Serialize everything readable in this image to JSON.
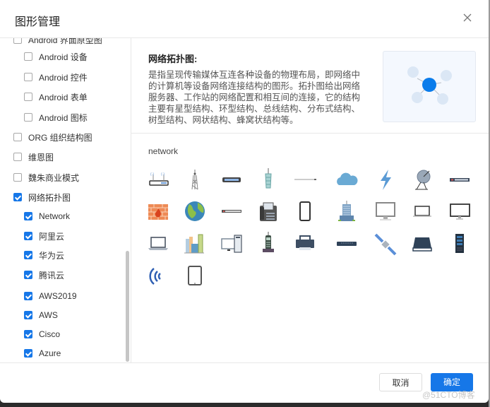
{
  "dialog": {
    "title": "图形管理",
    "close_icon": "close-icon"
  },
  "tree": {
    "items": [
      {
        "label": "Android 界面原型图",
        "checked": false,
        "level": 1,
        "partially_visible": true
      },
      {
        "label": "Android 设备",
        "checked": false,
        "level": 2
      },
      {
        "label": "Android 控件",
        "checked": false,
        "level": 2
      },
      {
        "label": "Android 表单",
        "checked": false,
        "level": 2
      },
      {
        "label": "Android 图标",
        "checked": false,
        "level": 2
      },
      {
        "label": "ORG 组织结构图",
        "checked": false,
        "level": 1
      },
      {
        "label": "维恩图",
        "checked": false,
        "level": 1
      },
      {
        "label": "魏朱商业模式",
        "checked": false,
        "level": 1
      },
      {
        "label": "网络拓扑图",
        "checked": true,
        "level": 1
      },
      {
        "label": "Network",
        "checked": true,
        "level": 2
      },
      {
        "label": "阿里云",
        "checked": true,
        "level": 2
      },
      {
        "label": "华为云",
        "checked": true,
        "level": 2
      },
      {
        "label": "腾讯云",
        "checked": true,
        "level": 2
      },
      {
        "label": "AWS2019",
        "checked": true,
        "level": 2
      },
      {
        "label": "AWS",
        "checked": true,
        "level": 2
      },
      {
        "label": "Cisco",
        "checked": true,
        "level": 2
      },
      {
        "label": "Azure",
        "checked": true,
        "level": 2
      }
    ]
  },
  "info": {
    "title": "网络拓扑图:",
    "description": "是指呈现传输媒体互连各种设备的物理布局，即网络中的计算机等设备网络连接结构的图形。拓扑图给出网络服务器、工作站的网络配置和相互间的连接，它的结构主要有星型结构、环型结构、总线结构、分布式结构、树型结构、网状结构、蜂窝状结构等。",
    "preview_icon": "network-topology-icon"
  },
  "shapes": {
    "section_title": "network",
    "icons": [
      "wireless-router-icon",
      "radio-tower-icon",
      "modem-icon",
      "cell-tower-icon",
      "cable-icon",
      "cloud-icon",
      "lightning-icon",
      "satellite-dish-icon",
      "switch-icon",
      "firewall-icon",
      "globe-icon",
      "patch-panel-icon",
      "fax-phone-icon",
      "smartphone-icon",
      "office-building-icon",
      "imac-monitor-icon",
      "laptop-screen-icon",
      "monitor-icon",
      "laptop-icon",
      "city-buildings-icon",
      "desktop-pc-icon",
      "cordless-phone-icon",
      "printer-icon",
      "hub-icon",
      "satellite-icon",
      "scanner-icon",
      "server-rack-icon",
      "wifi-signal-icon",
      "tablet-icon"
    ]
  },
  "footer": {
    "cancel_label": "取消",
    "ok_label": "确定"
  },
  "watermark": "@51CTO博客",
  "colors": {
    "accent": "#1677e8",
    "checkbox_border": "#a8a8a8",
    "preview_bg": "#f4f8fe"
  }
}
